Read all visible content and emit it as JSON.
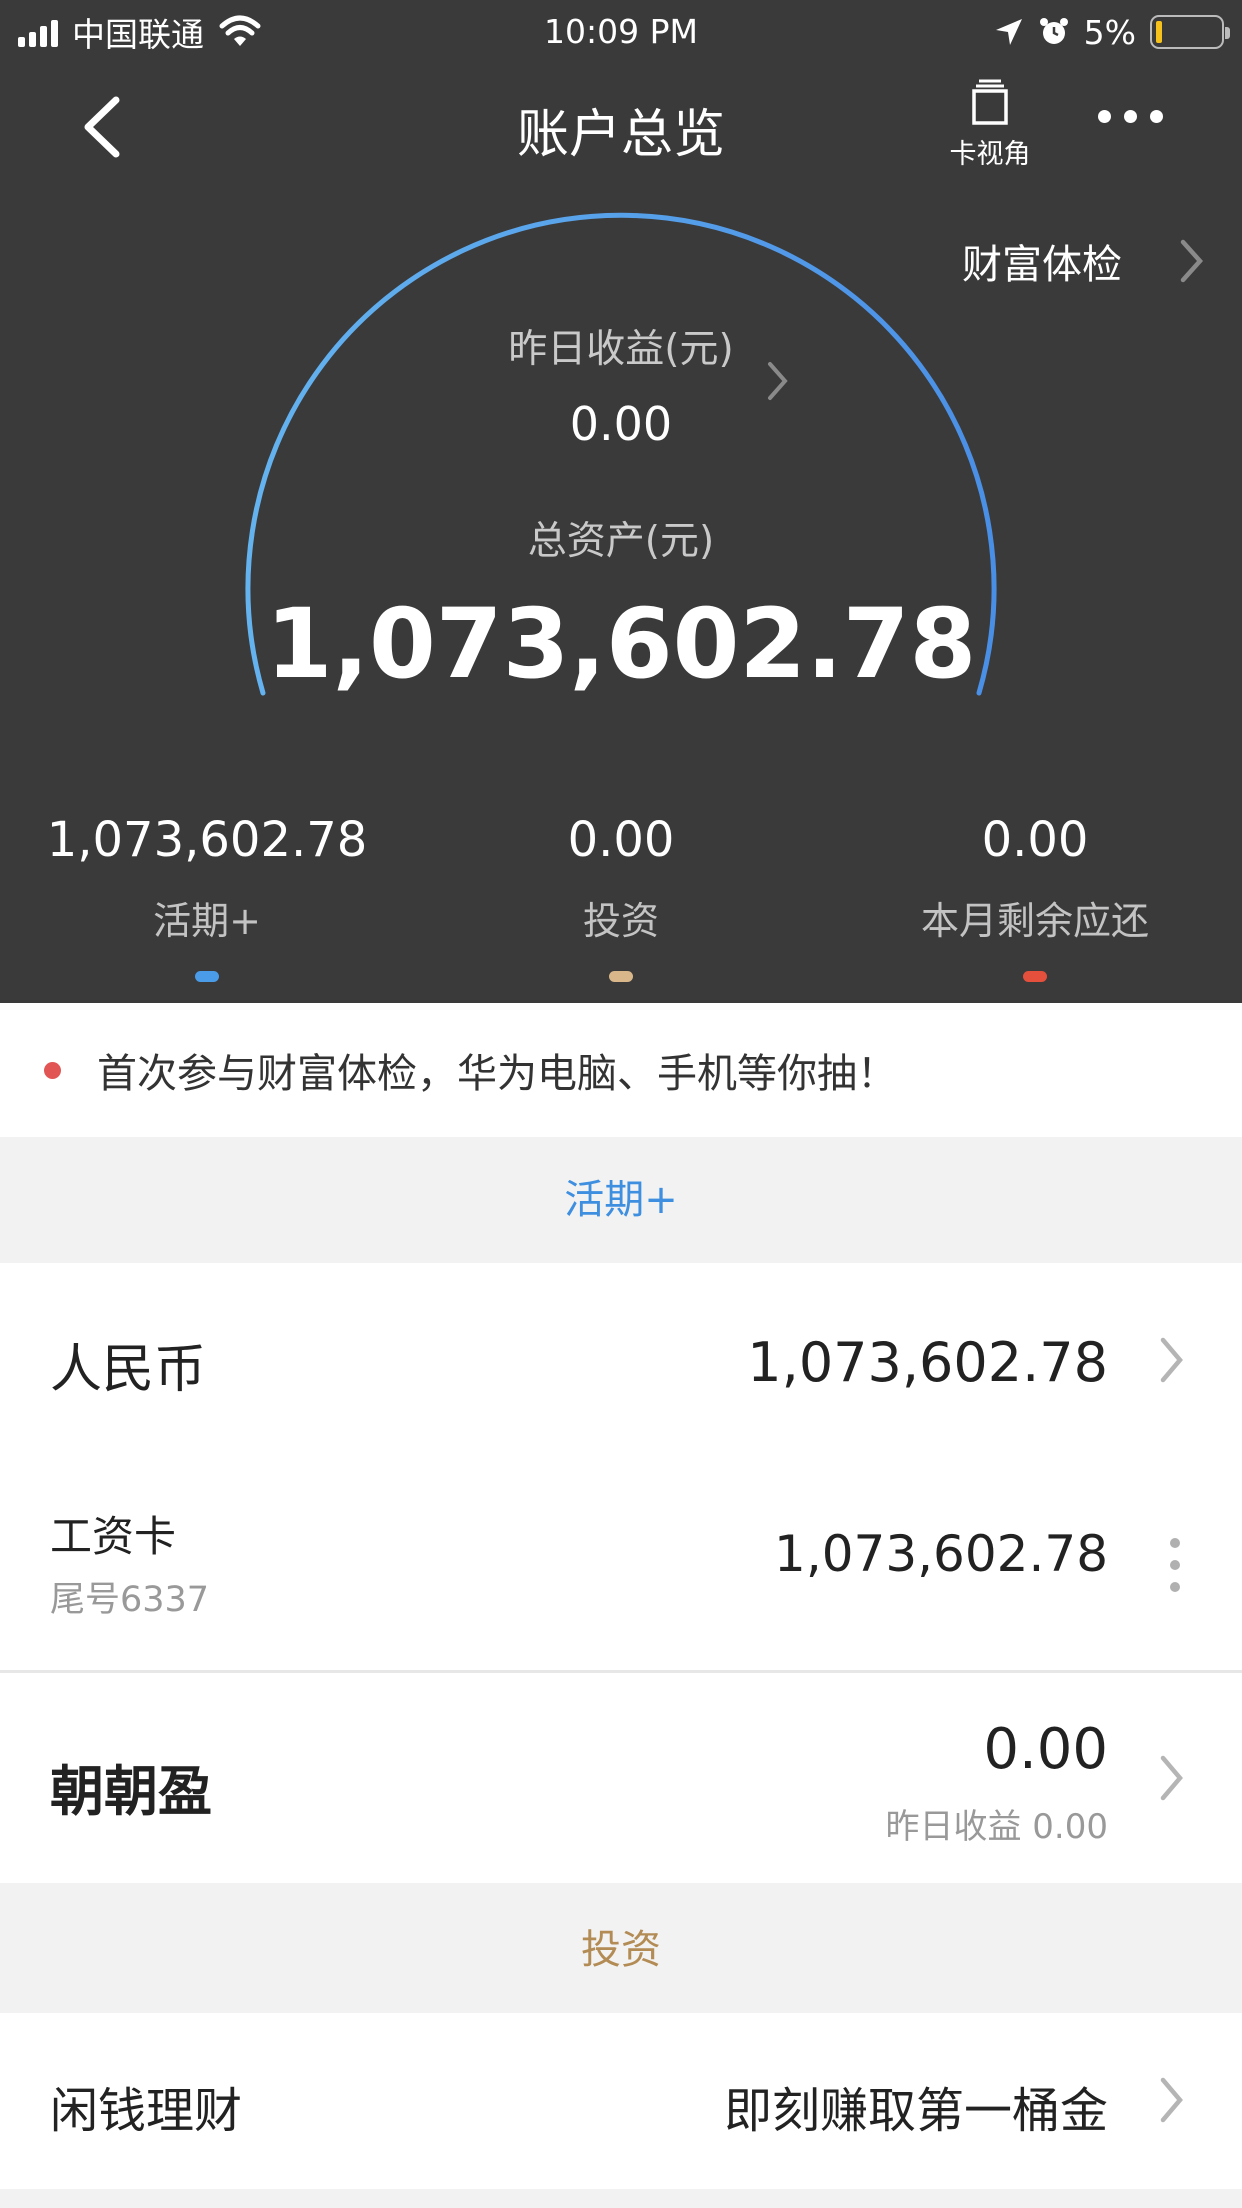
{
  "status_bar": {
    "carrier": "中国联通",
    "time": "10:09 PM",
    "battery": "5%"
  },
  "nav": {
    "title": "账户总览",
    "card_view_label": "卡视角"
  },
  "wealth_check": "财富体检",
  "gauge": {
    "yesterday_label": "昨日收益(元)",
    "yesterday_value": "0.00",
    "total_label": "总资产(元)",
    "total_value": "1,073,602.78"
  },
  "stats": [
    {
      "value": "1,073,602.78",
      "label": "活期+",
      "color": "#4a9ce8"
    },
    {
      "value": "0.00",
      "label": "投资",
      "color": "#d9b78a"
    },
    {
      "value": "0.00",
      "label": "本月剩余应还",
      "color": "#e4503c"
    }
  ],
  "promo": "首次参与财富体检，华为电脑、手机等你抽！",
  "sections": {
    "current": {
      "title": "活期+",
      "color": "#3f8fe0"
    },
    "invest": {
      "title": "投资",
      "color": "#b38b55"
    }
  },
  "rmb_row": {
    "title": "人民币",
    "amount": "1,073,602.78"
  },
  "salary_row": {
    "title": "工资卡",
    "sub": "尾号6337",
    "amount": "1,073,602.78"
  },
  "zzy_row": {
    "title": "朝朝盈",
    "amount": "0.00",
    "sub": "昨日收益 0.00"
  },
  "idle_row": {
    "title": "闲钱理财",
    "value": "即刻赚取第一桶金"
  }
}
